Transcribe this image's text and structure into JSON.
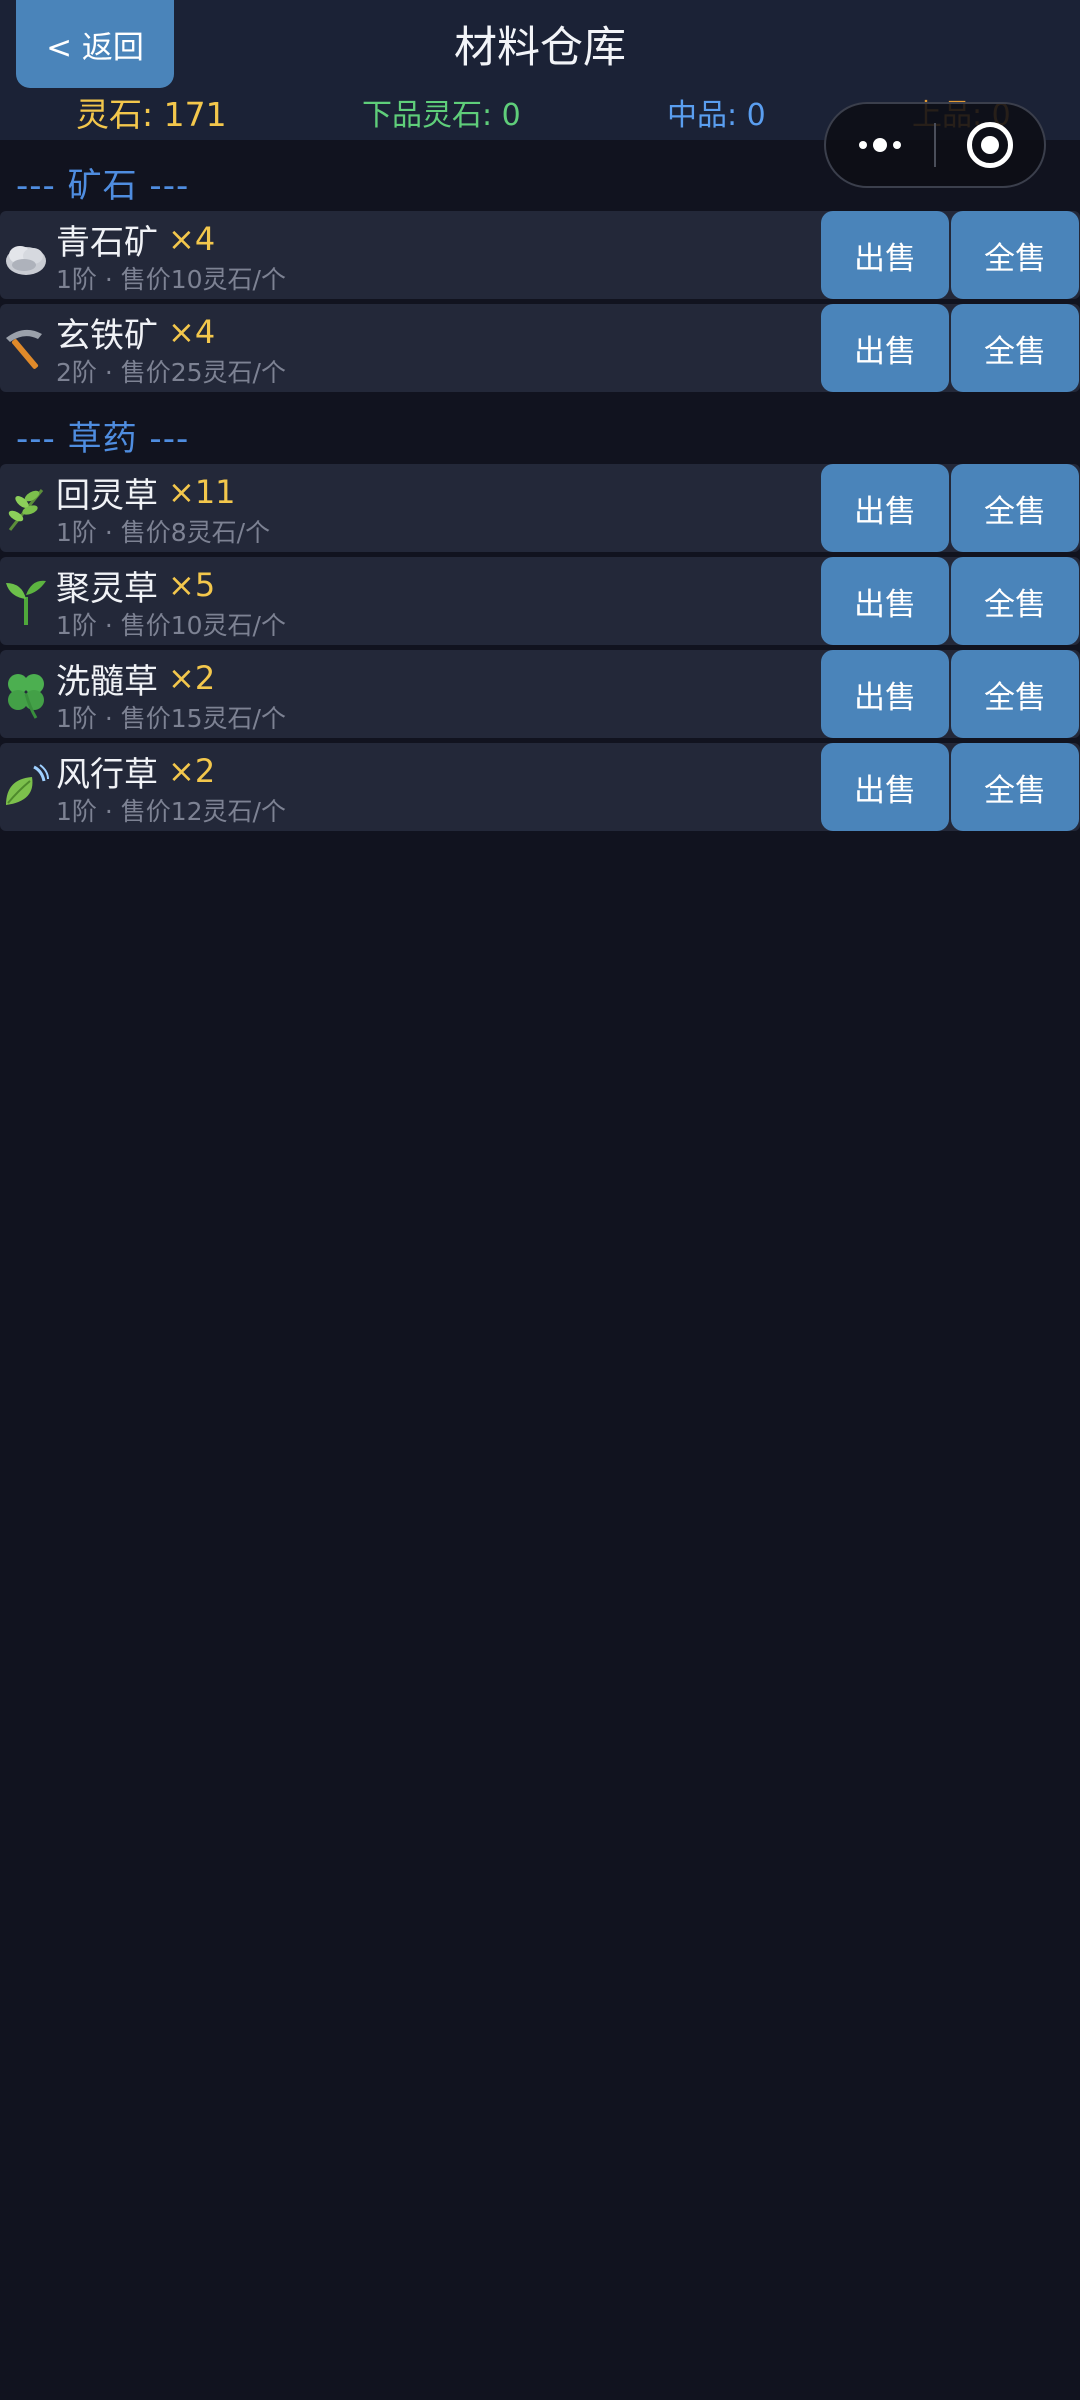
{
  "header": {
    "back_label": "< 返回",
    "title": "材料仓库"
  },
  "stats": {
    "spirit_stone": "灵石: 171",
    "low_grade": "下品灵石: 0",
    "mid_grade": "中品: 0",
    "high_grade": "上品: 0"
  },
  "capsule": {
    "more_icon": "more-dots-icon",
    "close_icon": "target-circle-icon"
  },
  "buttons": {
    "sell": "出售",
    "sell_all": "全售"
  },
  "sections": [
    {
      "title": "--- 矿石 ---",
      "items": [
        {
          "icon": "rock-icon",
          "name": "青石矿",
          "count": "×4",
          "desc": "1阶 · 售价10灵石/个"
        },
        {
          "icon": "pickaxe-icon",
          "name": "玄铁矿",
          "count": "×4",
          "desc": "2阶 · 售价25灵石/个"
        }
      ]
    },
    {
      "title": "--- 草药 ---",
      "items": [
        {
          "icon": "herb-icon",
          "name": "回灵草",
          "count": "×11",
          "desc": "1阶 · 售价8灵石/个"
        },
        {
          "icon": "seedling-icon",
          "name": "聚灵草",
          "count": "×5",
          "desc": "1阶 · 售价10灵石/个"
        },
        {
          "icon": "clover-icon",
          "name": "洗髓草",
          "count": "×2",
          "desc": "1阶 · 售价15灵石/个"
        },
        {
          "icon": "leaf-wind-icon",
          "name": "风行草",
          "count": "×2",
          "desc": "1阶 · 售价12灵石/个"
        }
      ]
    }
  ]
}
